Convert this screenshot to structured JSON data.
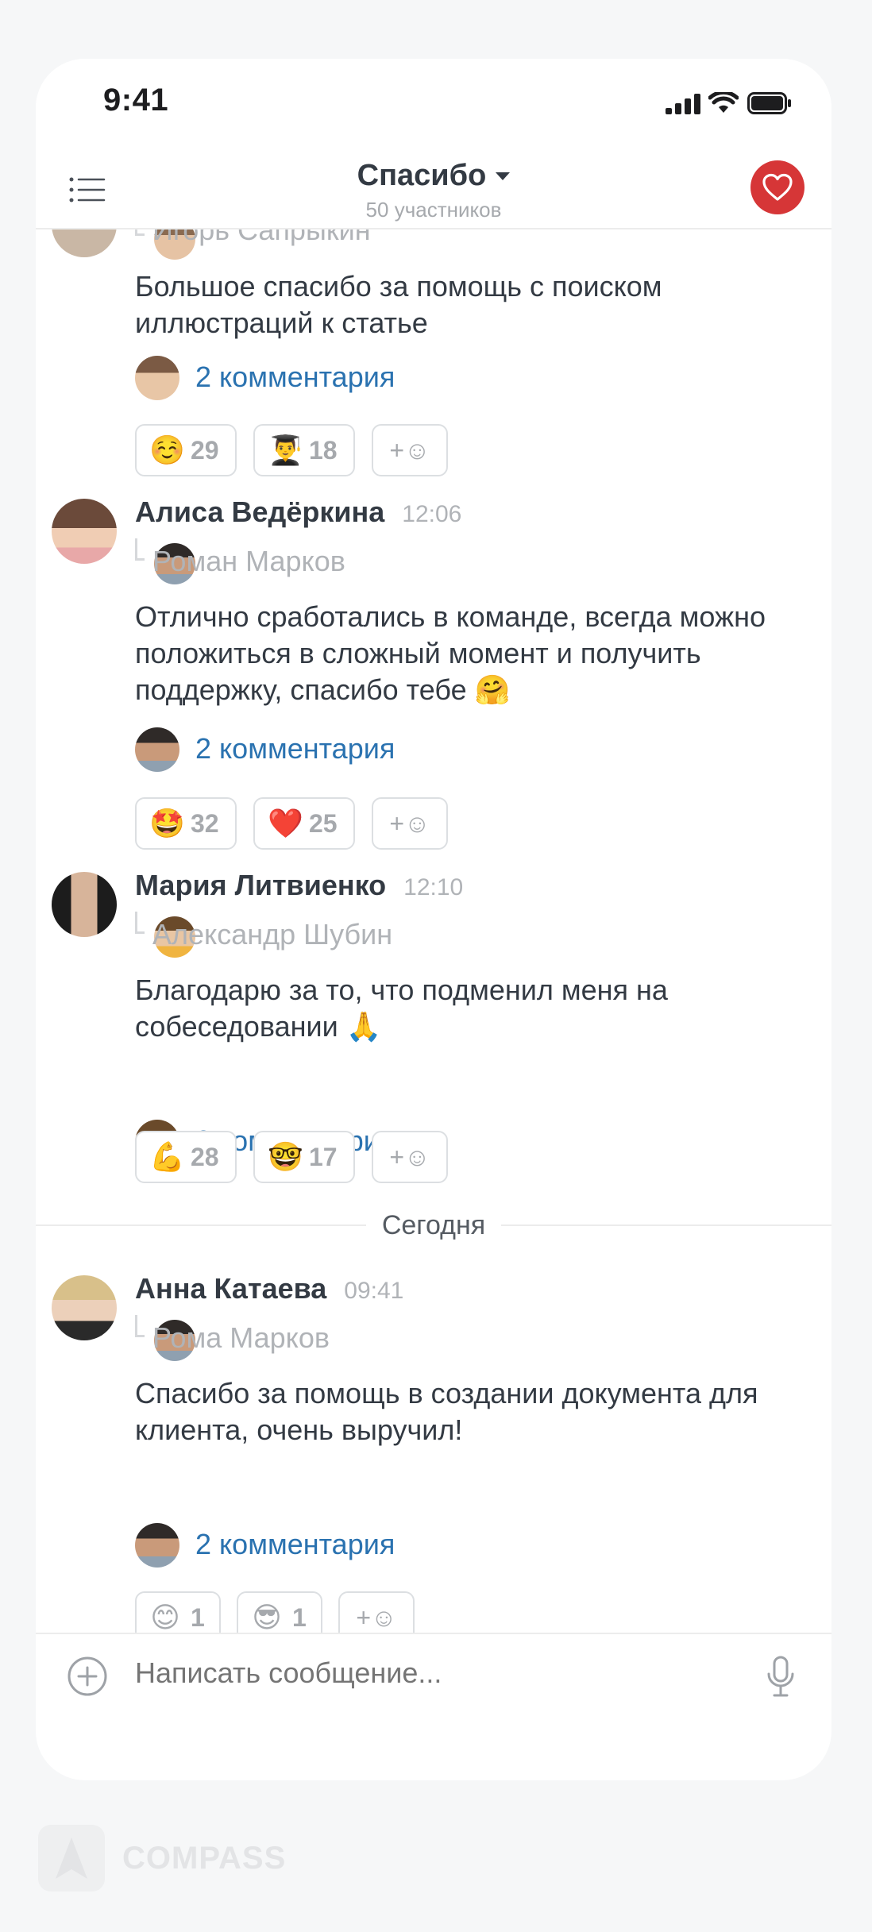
{
  "status_bar": {
    "time": "9:41"
  },
  "header": {
    "title": "Спасибо",
    "subtitle": "50 участников"
  },
  "messages": [
    {
      "reply_to": "Игорь Сапрыкин",
      "text": "Большое спасибо за помощь с поиском иллюстраций к статье",
      "comments": "2 комментария",
      "reactions": [
        {
          "emoji": "☺️",
          "count": "29"
        },
        {
          "emoji": "👨‍🎓",
          "count": "18"
        }
      ]
    },
    {
      "author": "Алиса Ведёркина",
      "time": "12:06",
      "reply_to": "Роман Марков",
      "text": "Отлично сработались в команде, всегда можно положиться в сложный момент и получить поддержку, спасибо тебе 🤗",
      "comments": "2 комментария",
      "reactions": [
        {
          "emoji": "🤩",
          "count": "32"
        },
        {
          "emoji": "❤️",
          "count": "25"
        }
      ]
    },
    {
      "author": "Мария Литвиенко",
      "time": "12:10",
      "reply_to": "Александр Шубин",
      "text": "Благодарю за то, что подменил меня на собеседовании 🙏",
      "comments": "2 комментария",
      "reactions": [
        {
          "emoji": "💪",
          "count": "28"
        },
        {
          "emoji": "🤓",
          "count": "17"
        }
      ]
    },
    {
      "author": "Анна Катаева",
      "time": "09:41",
      "reply_to": "Рома Марков",
      "text": "Спасибо за помощь в создании документа для клиента, очень выручил!",
      "comments": "2 комментария",
      "reactions": [
        {
          "emoji": "😊",
          "count": "1"
        },
        {
          "emoji": "😎",
          "count": "1"
        }
      ]
    }
  ],
  "add_reaction_label": "+☺",
  "date_divider": "Сегодня",
  "composer": {
    "placeholder": "Написать сообщение..."
  },
  "brand": {
    "name": "COMPASS"
  },
  "colors": {
    "accent_red": "#d63637",
    "link_blue": "#2a72b0"
  }
}
